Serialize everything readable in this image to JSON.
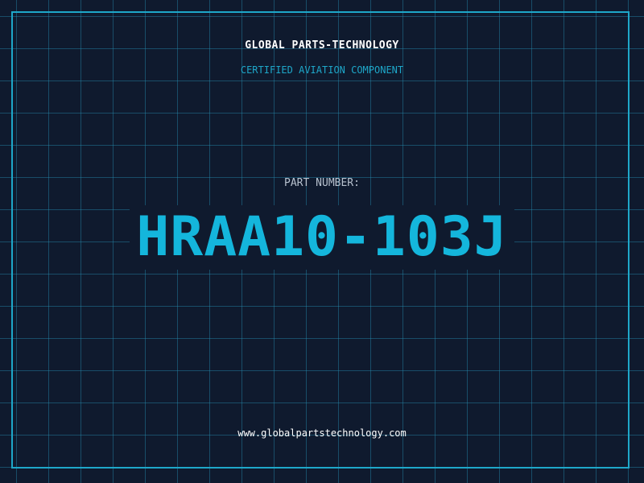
{
  "header": {
    "brand": "GLOBAL PARTS-TECHNOLOGY",
    "tagline": "CERTIFIED AVIATION COMPONENT"
  },
  "main": {
    "label": "PART NUMBER:",
    "part_number": "HRAA10-103J"
  },
  "footer": {
    "website": "www.globalpartstechnology.com"
  },
  "colors": {
    "background": "#0f1a2e",
    "accent": "#14b6dc",
    "frame": "#1ea7c9",
    "text": "#ffffff",
    "muted": "#b8c2cf"
  }
}
